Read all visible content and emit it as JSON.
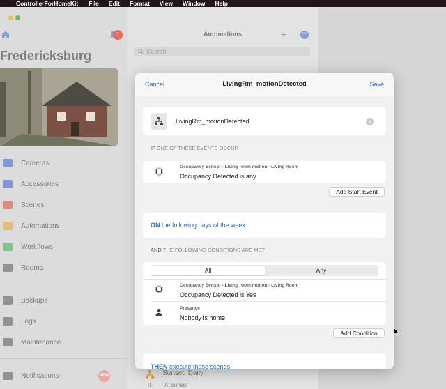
{
  "menubar": {
    "app": "ControllerForHomeKit",
    "items": [
      "File",
      "Edit",
      "Format",
      "View",
      "Window",
      "Help"
    ]
  },
  "sidebar": {
    "location": "Fredericksburg",
    "badge": "1",
    "nav": [
      {
        "label": "Cameras",
        "icon": "camera-icon",
        "color": "#3c5bd6"
      },
      {
        "label": "Accessories",
        "icon": "accessories-icon",
        "color": "#3c5bd6"
      },
      {
        "label": "Scenes",
        "icon": "scenes-icon",
        "color": "#e0453a"
      },
      {
        "label": "Automations",
        "icon": "automations-icon",
        "color": "#e5a22a"
      },
      {
        "label": "Workflows",
        "icon": "workflows-icon",
        "color": "#3fae4a"
      },
      {
        "label": "Rooms",
        "icon": "rooms-icon",
        "color": "#555555"
      },
      {
        "label": "Backups",
        "icon": "backups-icon",
        "color": "#555555"
      },
      {
        "label": "Logs",
        "icon": "logs-icon",
        "color": "#555555"
      },
      {
        "label": "Maintenance",
        "icon": "maintenance-icon",
        "color": "#555555"
      },
      {
        "label": "Notifications",
        "icon": "notifications-icon",
        "color": "#555555"
      }
    ],
    "notifications_badge": "NEW"
  },
  "middle": {
    "title": "Automations",
    "search_placeholder": "Search",
    "row": {
      "title": "Sunset, Daily",
      "if": "IF",
      "subtitle": "At sunset"
    }
  },
  "sheet": {
    "cancel": "Cancel",
    "title": "LivingRm_motionDetected",
    "save": "Save",
    "name_value": "LivingRm_motionDetected",
    "if_label_strong": "IF",
    "if_label_rest": "ONE OF THESE EVENTS OCCUR",
    "event": {
      "subtitle": "Occupancy Sensor - Living room motion - Living Room",
      "main": "Occupancy Detected is any"
    },
    "add_start_event": "Add Start Event",
    "days_strong": "ON",
    "days_rest": "the following days of the week",
    "cond_label_strong": "AND",
    "cond_label_rest": "THE FOLLOWING CONDITIONS ARE MET",
    "segment": {
      "all": "All",
      "any": "Any"
    },
    "conditions": [
      {
        "subtitle": "Occupancy Sensor - Living room motion - Living Room",
        "main": "Occupancy Detected is Yes"
      },
      {
        "subtitle": "Presence",
        "main": "Nobody is home"
      }
    ],
    "add_condition": "Add Condition",
    "then_strong": "THEN",
    "then_rest": "execute these scenes"
  },
  "colors": {
    "accent": "#1e6fd6",
    "menubar": "#241516",
    "badge": "#e56a5f"
  }
}
